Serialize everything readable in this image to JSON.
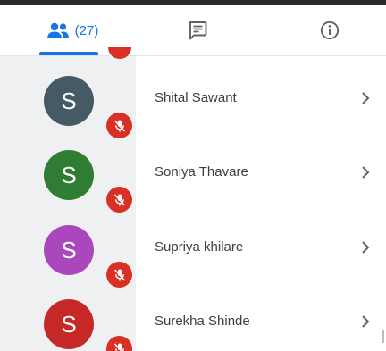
{
  "tabs": {
    "people_count": "(27)",
    "active": "people"
  },
  "participants": [
    {
      "initial": "S",
      "name": "Shital Sawant",
      "avatar_color": "#455a64",
      "mic": "muted"
    },
    {
      "initial": "S",
      "name": "Soniya Thavare",
      "avatar_color": "#2e7d32",
      "mic": "muted"
    },
    {
      "initial": "S",
      "name": "Supriya khilare",
      "avatar_color": "#ab47bc",
      "mic": "muted"
    },
    {
      "initial": "S",
      "name": "Surekha Shinde",
      "avatar_color": "#c62828",
      "mic": "muted"
    }
  ],
  "colors": {
    "accent": "#1a73e8",
    "muted_badge": "#d93025",
    "rail": "#eef0f1"
  },
  "icons": {
    "people_tab": "people-icon",
    "chat_tab": "chat-icon",
    "info_tab": "info-icon",
    "mic": "mic-off-icon",
    "row_action": "chevron-right-icon"
  }
}
